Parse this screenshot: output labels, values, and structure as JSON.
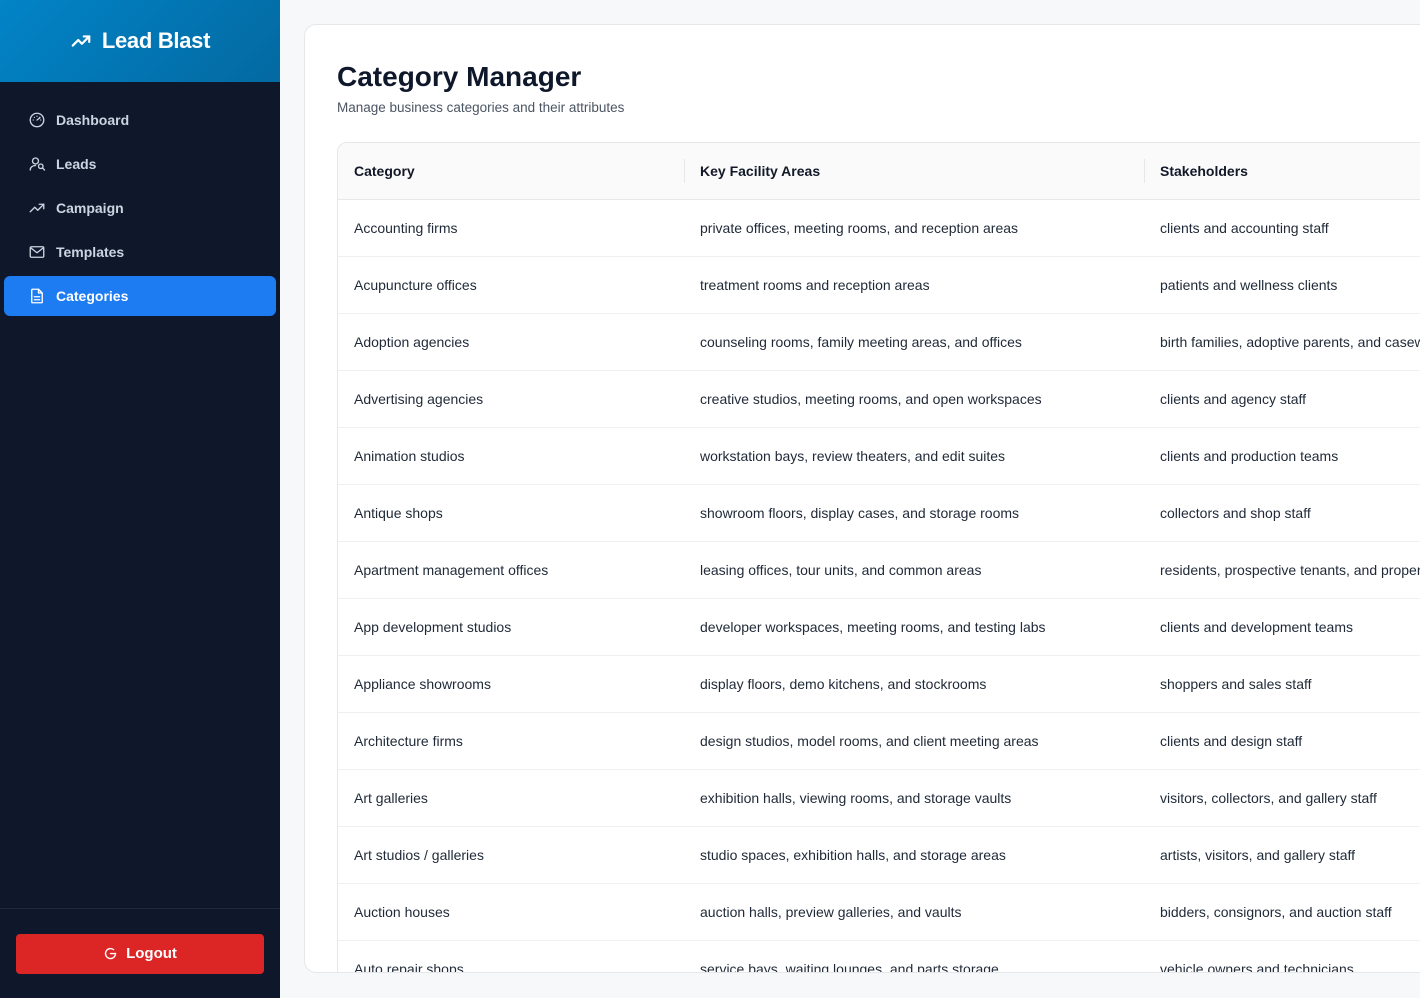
{
  "app": {
    "brand": "Lead Blast"
  },
  "sidebar": {
    "items": [
      {
        "label": "Dashboard",
        "icon": "gauge-icon",
        "active": false
      },
      {
        "label": "Leads",
        "icon": "users-icon",
        "active": false
      },
      {
        "label": "Campaign",
        "icon": "trending-up-icon",
        "active": false
      },
      {
        "label": "Templates",
        "icon": "mail-icon",
        "active": false
      },
      {
        "label": "Categories",
        "icon": "file-text-icon",
        "active": true
      }
    ],
    "logout_label": "Logout"
  },
  "page": {
    "title": "Category Manager",
    "subtitle": "Manage business categories and their attributes"
  },
  "table": {
    "columns": [
      "Category",
      "Key Facility Areas",
      "Stakeholders"
    ],
    "rows": [
      [
        "Accounting firms",
        "private offices, meeting rooms, and reception areas",
        "clients and accounting staff"
      ],
      [
        "Acupuncture offices",
        "treatment rooms and reception areas",
        "patients and wellness clients"
      ],
      [
        "Adoption agencies",
        "counseling rooms, family meeting areas, and offices",
        "birth families, adoptive parents, and casew"
      ],
      [
        "Advertising agencies",
        "creative studios, meeting rooms, and open workspaces",
        "clients and agency staff"
      ],
      [
        "Animation studios",
        "workstation bays, review theaters, and edit suites",
        "clients and production teams"
      ],
      [
        "Antique shops",
        "showroom floors, display cases, and storage rooms",
        "collectors and shop staff"
      ],
      [
        "Apartment management offices",
        "leasing offices, tour units, and common areas",
        "residents, prospective tenants, and proper"
      ],
      [
        "App development studios",
        "developer workspaces, meeting rooms, and testing labs",
        "clients and development teams"
      ],
      [
        "Appliance showrooms",
        "display floors, demo kitchens, and stockrooms",
        "shoppers and sales staff"
      ],
      [
        "Architecture firms",
        "design studios, model rooms, and client meeting areas",
        "clients and design staff"
      ],
      [
        "Art galleries",
        "exhibition halls, viewing rooms, and storage vaults",
        "visitors, collectors, and gallery staff"
      ],
      [
        "Art studios / galleries",
        "studio spaces, exhibition halls, and storage areas",
        "artists, visitors, and gallery staff"
      ],
      [
        "Auction houses",
        "auction halls, preview galleries, and vaults",
        "bidders, consignors, and auction staff"
      ],
      [
        "Auto repair shops",
        "service bays, waiting lounges, and parts storage",
        "vehicle owners and technicians"
      ]
    ]
  },
  "colors": {
    "sidebar_bg": "#0f172a",
    "brand_gradient_start": "#0284c7",
    "active_item": "#1d7cf2",
    "logout": "#dc2626"
  }
}
